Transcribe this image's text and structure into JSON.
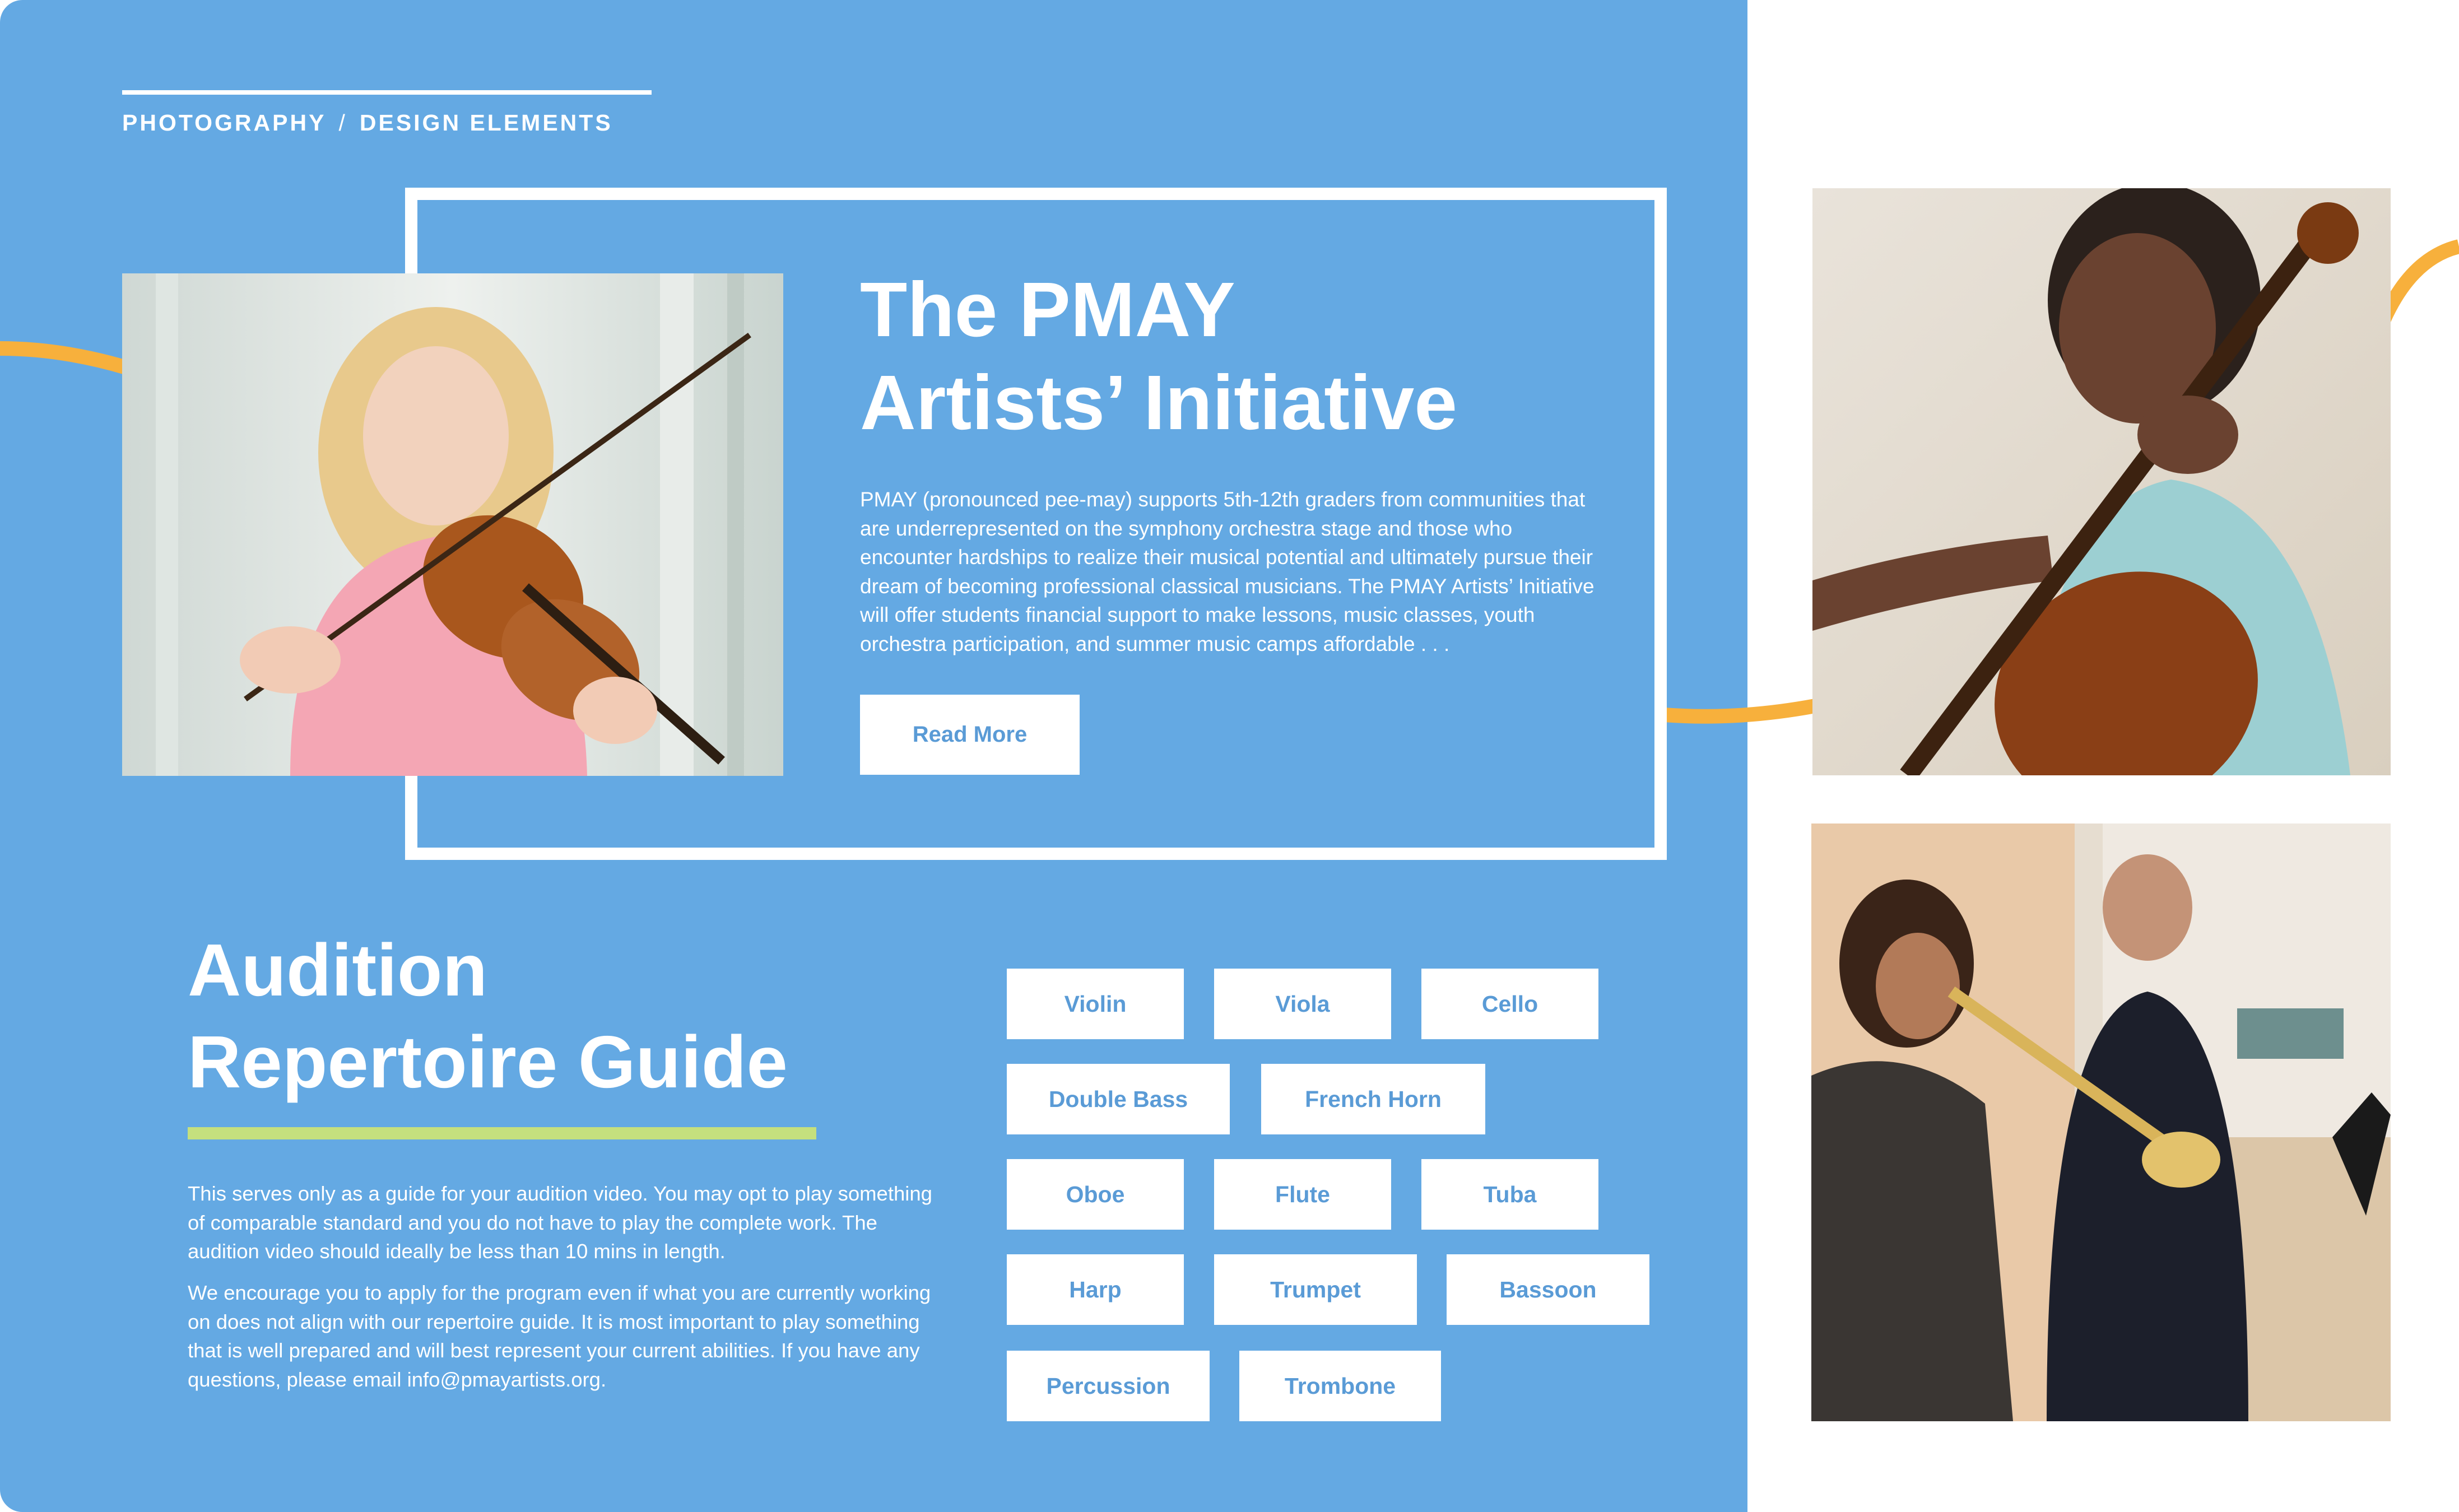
{
  "breadcrumb": {
    "section": "PHOTOGRAPHY",
    "separator": "/",
    "page": "DESIGN ELEMENTS"
  },
  "hero": {
    "title_line1": "The PMAY",
    "title_line2": "Artists’ Initiative",
    "body": "PMAY (pronounced pee-may) supports 5th-12th graders from communities that are underrepresented on the symphony orchestra stage and those who encounter hardships to realize their musical potential and ultimately pursue their dream of becoming professional classical musicians. The PMAY Artists’ Initiative will offer students financial support to make lessons, music classes, youth orchestra participation, and summer music camps affordable . . .",
    "read_more_label": "Read More"
  },
  "audition": {
    "title_line1": "Audition",
    "title_line2": "Repertoire Guide",
    "paragraph1": "This serves only as a guide for your audition video. You may opt to play something of comparable standard and you do not have to play the complete work. The audition video should ideally be less than 10 mins in length.",
    "paragraph2": "We encourage you to apply for the program even if what you are currently working on does not align with our repertoire guide. It is most important to play something that is well prepared and will best represent your current abilities. If you have any questions, please email info@pmayartists.org."
  },
  "instruments": [
    "Violin",
    "Viola",
    "Cello",
    "Double Bass",
    "French Horn",
    "Oboe",
    "Flute",
    "Tuba",
    "Harp",
    "Trumpet",
    "Bassoon",
    "Percussion",
    "Trombone"
  ],
  "colors": {
    "panel_blue": "#64a9e3",
    "accent_orange": "#f7b03c",
    "accent_green": "#c5e07e",
    "chip_text": "#5a9bd6",
    "white": "#ffffff"
  },
  "images": [
    {
      "name": "girl-playing-violin-photo"
    },
    {
      "name": "girl-playing-cello-photo"
    },
    {
      "name": "trumpet-lesson-photo"
    }
  ]
}
